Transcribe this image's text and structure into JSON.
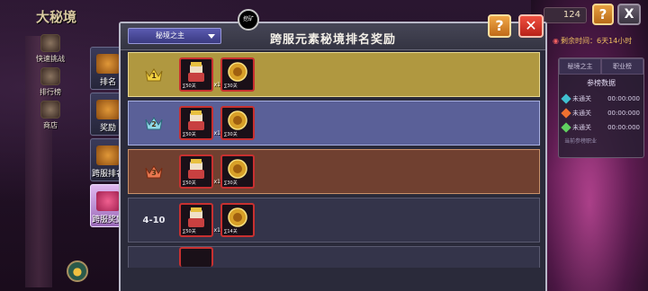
{
  "game": {
    "title": "大秘境"
  },
  "left_nav": [
    {
      "label": "快速挑战"
    },
    {
      "label": "排行榜"
    },
    {
      "label": "商店"
    }
  ],
  "hud": {
    "counter": "124",
    "help": "?",
    "close": "X",
    "season_time": "剩余时间：6天14小时"
  },
  "side_panel": {
    "tabs": [
      "秘境之主",
      "职业榜"
    ],
    "title": "参榜数据",
    "rows": [
      {
        "status": "未通关",
        "time": "00:00:000",
        "gem_color": "#40c0d0"
      },
      {
        "status": "未通关",
        "time": "00:00:000",
        "gem_color": "#f07030"
      },
      {
        "status": "未通关",
        "time": "00:00:000",
        "gem_color": "#60d060"
      }
    ],
    "footer": "当前参榜职业"
  },
  "modal": {
    "title": "跨服元素秘境排名奖励",
    "dropdown_value": "秘境之主",
    "top_badge": "挖矿",
    "help": "?",
    "close": "✕",
    "tabs": [
      {
        "label": "排名",
        "active": false
      },
      {
        "label": "奖励",
        "active": false
      },
      {
        "label": "跨服排名",
        "active": false
      },
      {
        "label": "跨服奖励",
        "active": true
      }
    ],
    "rows": [
      {
        "rank": "1",
        "style": "gold",
        "crown_color": "#f0d040",
        "items": [
          {
            "sub": "∑50关",
            "qty": "x1"
          },
          {
            "sub": "∑30关",
            "qty": ""
          }
        ]
      },
      {
        "rank": "2",
        "style": "silver",
        "crown_color": "#90d8e8",
        "items": [
          {
            "sub": "∑50关",
            "qty": "x1"
          },
          {
            "sub": "∑30关",
            "qty": ""
          }
        ]
      },
      {
        "rank": "3",
        "style": "bronze",
        "crown_color": "#e87850",
        "items": [
          {
            "sub": "∑50关",
            "qty": "x1"
          },
          {
            "sub": "∑30关",
            "qty": ""
          }
        ]
      },
      {
        "rank": "4-10",
        "style": "plain",
        "crown_color": "",
        "items": [
          {
            "sub": "∑50关",
            "qty": "x1"
          },
          {
            "sub": "∑14关",
            "qty": ""
          }
        ]
      }
    ]
  }
}
